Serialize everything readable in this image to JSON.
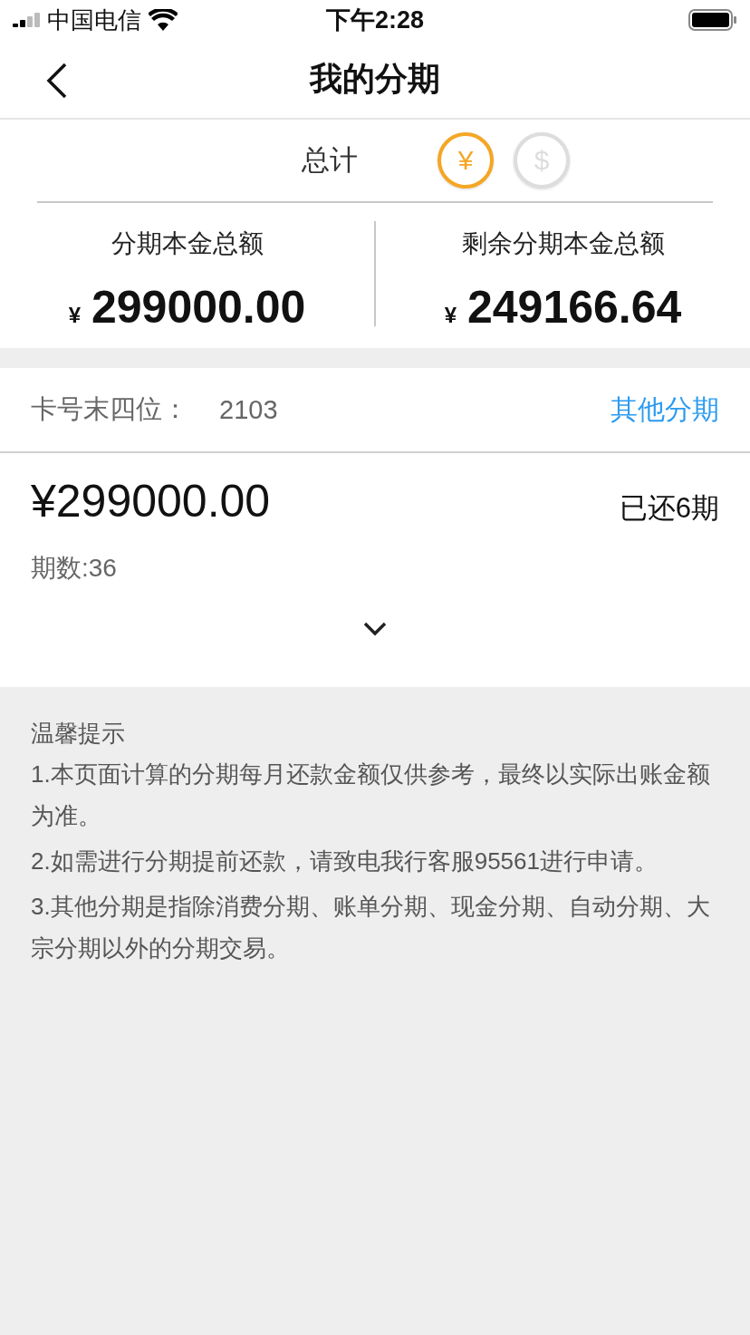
{
  "status_bar": {
    "carrier": "中国电信",
    "time": "下午2:28"
  },
  "nav": {
    "title": "我的分期"
  },
  "summary": {
    "label": "总计",
    "currencies": [
      {
        "symbol": "¥",
        "selected": true
      },
      {
        "symbol": "$",
        "selected": false
      }
    ],
    "stats": [
      {
        "label": "分期本金总额",
        "sign": "¥",
        "amount": "299000.00"
      },
      {
        "label": "剩余分期本金总额",
        "sign": "¥",
        "amount": "249166.64"
      }
    ]
  },
  "card": {
    "label": "卡号末四位：",
    "number": "2103",
    "link": "其他分期"
  },
  "plans": [
    {
      "amount": "¥299000.00",
      "status": "已还6期",
      "periods": "期数:36",
      "expanded": false
    }
  ],
  "tips": {
    "title": "温馨提示",
    "items": [
      "1.本页面计算的分期每月还款金额仅供参考，最终以实际出账金额为准。",
      "2.如需进行分期提前还款，请致电我行客服95561进行申请。",
      "3.其他分期是指除消费分期、账单分期、现金分期、自动分期、大宗分期以外的分期交易。"
    ]
  }
}
